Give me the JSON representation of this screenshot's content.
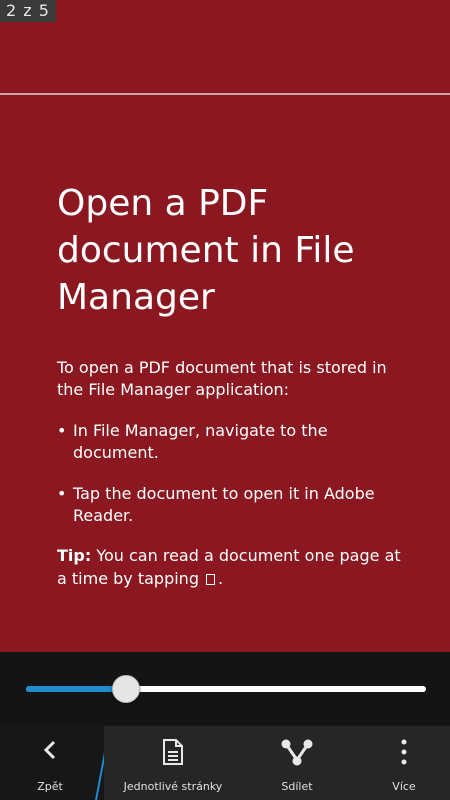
{
  "page_indicator": "2 z 5",
  "document": {
    "title": "Open a PDF document in File Manager",
    "intro": "To open a PDF document that is stored in the File Manager application:",
    "bullets": [
      "In File Manager, navigate to the document.",
      "Tap the document to open it in Adobe Reader."
    ],
    "tip_label": "Tip:",
    "tip_text": "You can read a document one page at a time by tapping",
    "tip_end": ".",
    "background_color": "#8b1820"
  },
  "slider": {
    "value_fraction": 0.25,
    "fill_color": "#1f8cd0"
  },
  "action_bar": {
    "back_label": "Zpět",
    "single_pages_label": "Jednotlivé stránky",
    "share_label": "Sdílet",
    "more_label": "Více",
    "accent_color": "#1f8cd0"
  }
}
